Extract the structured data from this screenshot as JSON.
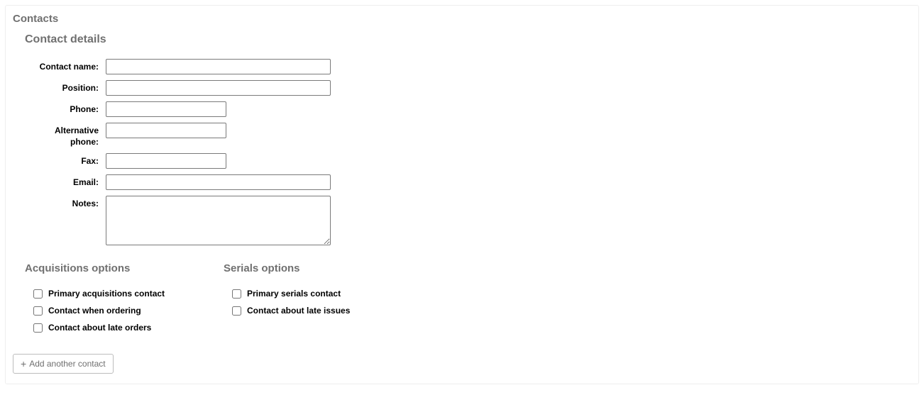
{
  "section": {
    "title": "Contacts",
    "sub_title": "Contact details"
  },
  "fields": {
    "contact_name": {
      "label": "Contact name:",
      "value": ""
    },
    "position": {
      "label": "Position:",
      "value": ""
    },
    "phone": {
      "label": "Phone:",
      "value": ""
    },
    "alt_phone": {
      "label": "Alternative phone:",
      "value": ""
    },
    "fax": {
      "label": "Fax:",
      "value": ""
    },
    "email": {
      "label": "Email:",
      "value": ""
    },
    "notes": {
      "label": "Notes:",
      "value": ""
    }
  },
  "acq": {
    "title": "Acquisitions options",
    "items": [
      {
        "label": "Primary acquisitions contact",
        "checked": false
      },
      {
        "label": "Contact when ordering",
        "checked": false
      },
      {
        "label": "Contact about late orders",
        "checked": false
      }
    ]
  },
  "serials": {
    "title": "Serials options",
    "items": [
      {
        "label": "Primary serials contact",
        "checked": false
      },
      {
        "label": "Contact about late issues",
        "checked": false
      }
    ]
  },
  "buttons": {
    "add_contact": "Add another contact"
  }
}
